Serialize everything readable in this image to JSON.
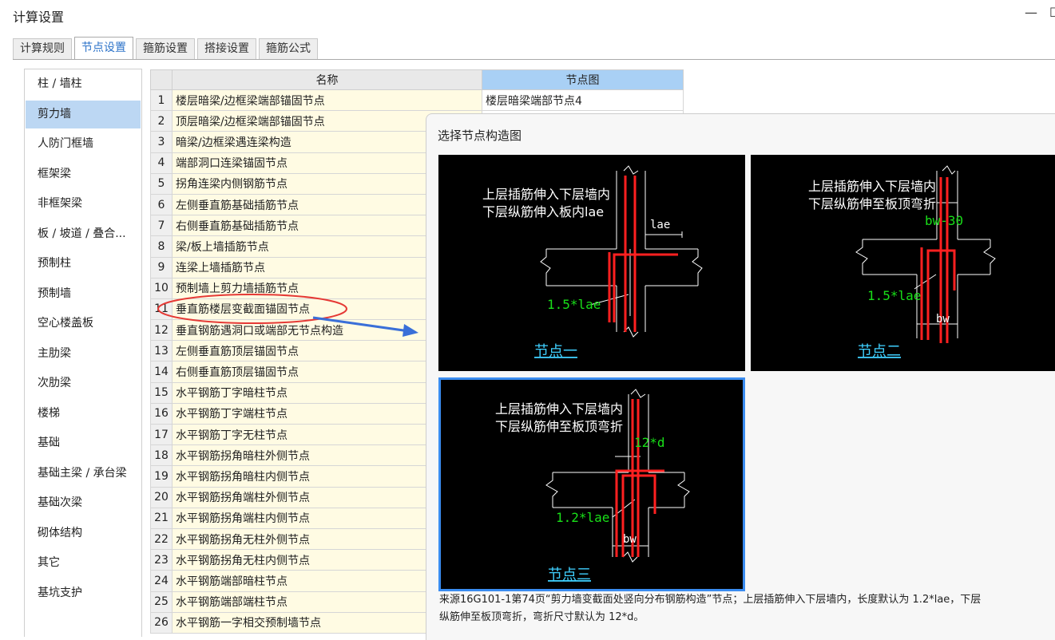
{
  "window": {
    "title": "计算设置",
    "minimize": "—",
    "restore": "☐"
  },
  "tabs": [
    "计算规则",
    "节点设置",
    "箍筋设置",
    "搭接设置",
    "箍筋公式"
  ],
  "active_tab": 1,
  "sidebar": [
    "柱 / 墙柱",
    "剪力墙",
    "人防门框墙",
    "框架梁",
    "非框架梁",
    "板 / 坡道 / 叠合...",
    "预制柱",
    "预制墙",
    "空心楼盖板",
    "主肋梁",
    "次肋梁",
    "楼梯",
    "基础",
    "基础主梁 / 承台梁",
    "基础次梁",
    "砌体结构",
    "其它",
    "基坑支护"
  ],
  "active_sidebar": 1,
  "table": {
    "col_name": "名称",
    "col_node": "节点图",
    "rows": [
      {
        "n": "1",
        "name": "楼层暗梁/边框梁端部锚固节点",
        "node": "楼层暗梁端部节点4"
      },
      {
        "n": "2",
        "name": "顶层暗梁/边框梁端部锚固节点",
        "node": ""
      },
      {
        "n": "3",
        "name": "暗梁/边框梁遇连梁构造",
        "node": ""
      },
      {
        "n": "4",
        "name": "端部洞口连梁锚固节点",
        "node": ""
      },
      {
        "n": "5",
        "name": "拐角连梁内侧钢筋节点",
        "node": ""
      },
      {
        "n": "6",
        "name": "左侧垂直筋基础插筋节点",
        "node": ""
      },
      {
        "n": "7",
        "name": "右侧垂直筋基础插筋节点",
        "node": ""
      },
      {
        "n": "8",
        "name": "梁/板上墙插筋节点",
        "node": ""
      },
      {
        "n": "9",
        "name": "连梁上墙插筋节点",
        "node": ""
      },
      {
        "n": "10",
        "name": "预制墙上剪力墙插筋节点",
        "node": ""
      },
      {
        "n": "11",
        "name": "垂直筋楼层变截面锚固节点",
        "node": ""
      },
      {
        "n": "12",
        "name": "垂直钢筋遇洞口或端部无节点构造",
        "node": ""
      },
      {
        "n": "13",
        "name": "左侧垂直筋顶层锚固节点",
        "node": ""
      },
      {
        "n": "14",
        "name": "右侧垂直筋顶层锚固节点",
        "node": ""
      },
      {
        "n": "15",
        "name": "水平钢筋丁字暗柱节点",
        "node": ""
      },
      {
        "n": "16",
        "name": "水平钢筋丁字端柱节点",
        "node": ""
      },
      {
        "n": "17",
        "name": "水平钢筋丁字无柱节点",
        "node": ""
      },
      {
        "n": "18",
        "name": "水平钢筋拐角暗柱外侧节点",
        "node": ""
      },
      {
        "n": "19",
        "name": "水平钢筋拐角暗柱内侧节点",
        "node": ""
      },
      {
        "n": "20",
        "name": "水平钢筋拐角端柱外侧节点",
        "node": ""
      },
      {
        "n": "21",
        "name": "水平钢筋拐角端柱内侧节点",
        "node": ""
      },
      {
        "n": "22",
        "name": "水平钢筋拐角无柱外侧节点",
        "node": ""
      },
      {
        "n": "23",
        "name": "水平钢筋拐角无柱内侧节点",
        "node": ""
      },
      {
        "n": "24",
        "name": "水平钢筋端部暗柱节点",
        "node": ""
      },
      {
        "n": "25",
        "name": "水平钢筋端部端柱节点",
        "node": ""
      },
      {
        "n": "26",
        "name": "水平钢筋一字相交预制墙节点",
        "node": ""
      }
    ]
  },
  "popup": {
    "title": "选择节点构造图",
    "thumbs": [
      {
        "line1": "上层插筋伸入下层墙内",
        "line2": "下层纵筋伸入板内lae",
        "dim_a": "lae",
        "dim_b": "1.5*lae",
        "label": "节点一"
      },
      {
        "line1": "上层插筋伸入下层墙内",
        "line2": "下层纵筋伸至板顶弯折",
        "dim_a": "bw-30",
        "dim_b": "1.5*lae",
        "dim_c": "bw",
        "label": "节点二"
      },
      {
        "line1": "上层插筋伸入下层墙内",
        "line2": "下层纵筋伸至板顶弯折",
        "dim_a": "12*d",
        "dim_b": "1.2*lae",
        "dim_c": "bw",
        "label": "节点三"
      }
    ],
    "selected": 2,
    "caption": "来源16G101-1第74页“剪力墙变截面处竖向分布钢筋构造”节点；上层插筋伸入下层墙内，长度默认为 1.2*lae，下层\n纵筋伸至板顶弯折，弯折尺寸默认为 12*d。"
  },
  "colors": {
    "selected_row_bg": "#bcd7f3",
    "header_highlight": "#a9d0f5",
    "name_cell_bg": "#fffbe3",
    "annotation": "#e53935",
    "arrow": "#3a6fd8",
    "rebar": "#ff2020",
    "dim_text": "#19e019",
    "label_text": "#3fd0ff"
  }
}
